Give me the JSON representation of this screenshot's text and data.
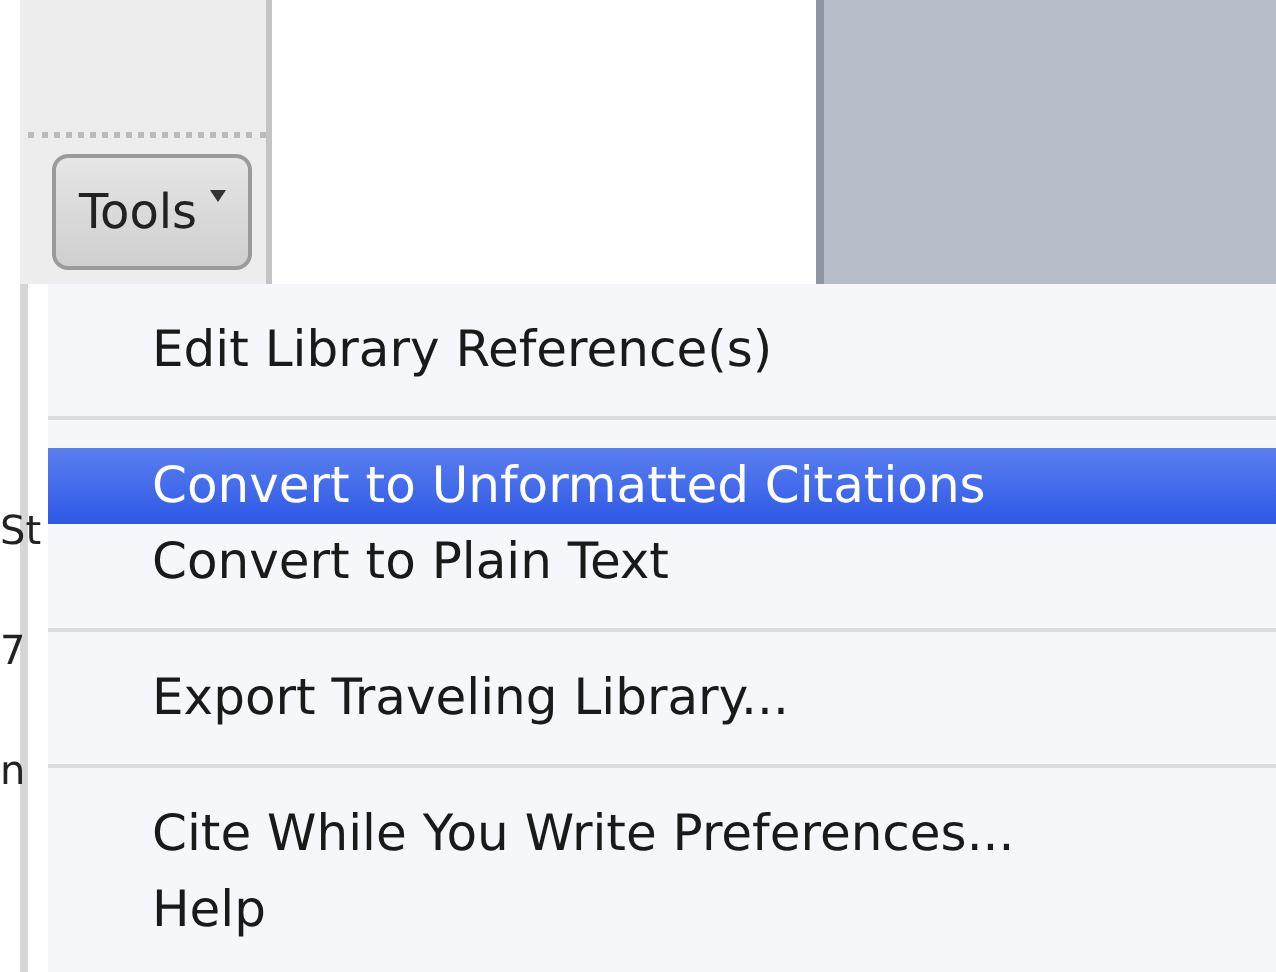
{
  "toolbar": {
    "tools_button": {
      "label": "Tools"
    }
  },
  "document": {
    "edge_fragments": [
      "St",
      "7",
      "n"
    ]
  },
  "menu": {
    "items": [
      {
        "kind": "item",
        "label": "Edit Library Reference(s)",
        "selected": false
      },
      {
        "kind": "separator"
      },
      {
        "kind": "item",
        "label": "Convert to Unformatted Citations",
        "selected": true
      },
      {
        "kind": "item",
        "label": "Convert to Plain Text",
        "selected": false
      },
      {
        "kind": "separator"
      },
      {
        "kind": "item",
        "label": "Export Traveling Library...",
        "selected": false
      },
      {
        "kind": "separator"
      },
      {
        "kind": "item",
        "label": "Cite While You Write Preferences...",
        "selected": false
      },
      {
        "kind": "item",
        "label": "Help",
        "selected": false
      }
    ]
  }
}
